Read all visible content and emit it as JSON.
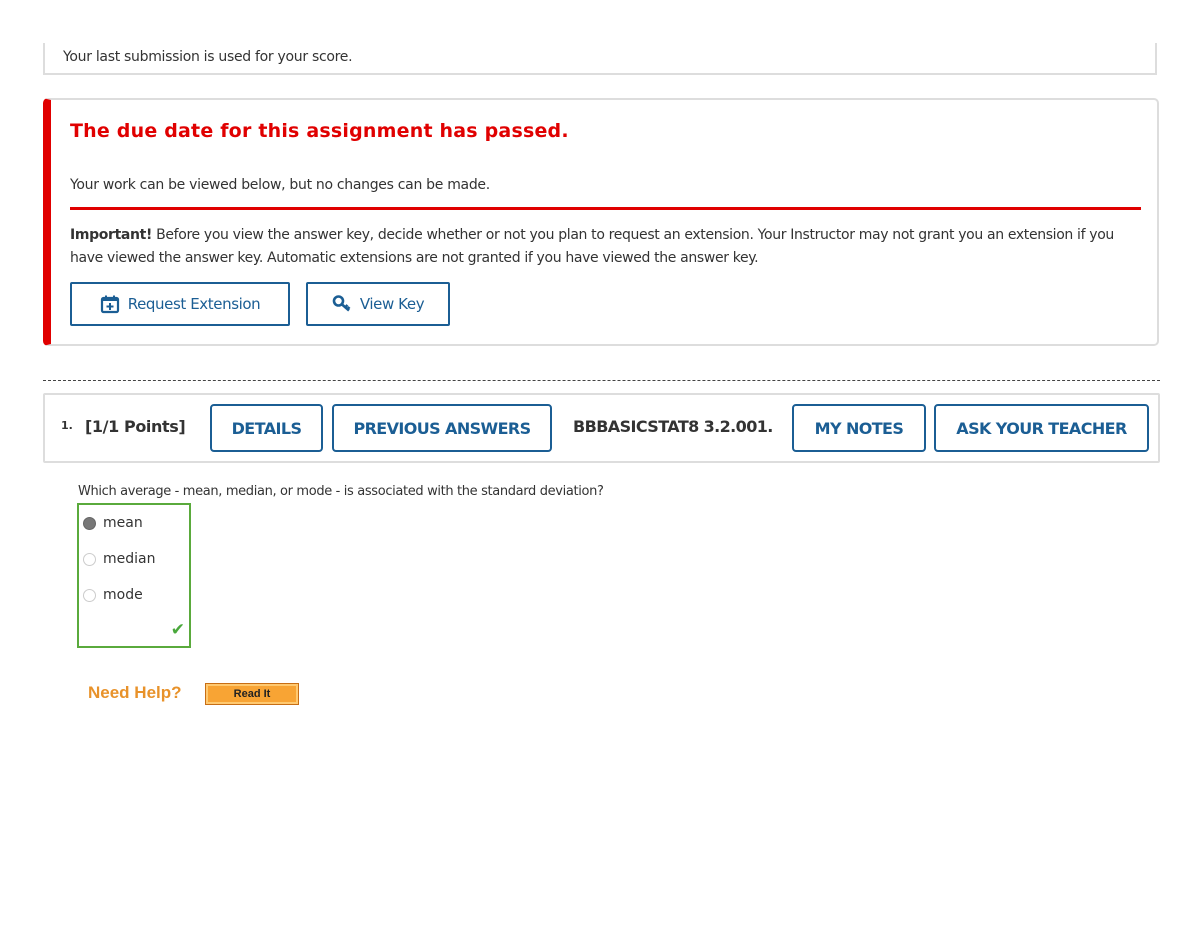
{
  "submission_note": "Your last submission is used for your score.",
  "alert": {
    "title": "The due date for this assignment has passed.",
    "subtitle": "Your work can be viewed below, but no changes can be made.",
    "important_label": "Important!",
    "important_text": " Before you view the answer key, decide whether or not you plan to request an extension. Your Instructor may not grant you an extension if you have viewed the answer key. Automatic extensions are not granted if you have viewed the answer key.",
    "request_extension_label": "Request Extension",
    "view_key_label": "View Key",
    "accent_color": "#e00000"
  },
  "question": {
    "number": "1.",
    "points": "[1/1 Points]",
    "details_label": "DETAILS",
    "previous_answers_label": "PREVIOUS ANSWERS",
    "code": "BBBASICSTAT8 3.2.001.",
    "my_notes_label": "MY NOTES",
    "ask_teacher_label": "ASK YOUR TEACHER",
    "text": "Which average - mean, median, or mode - is associated with the standard deviation?",
    "options": [
      {
        "label": "mean",
        "selected": true
      },
      {
        "label": "median",
        "selected": false
      },
      {
        "label": "mode",
        "selected": false
      }
    ],
    "result": "correct"
  },
  "help": {
    "label": "Need Help?",
    "read_it_label": "Read It"
  }
}
